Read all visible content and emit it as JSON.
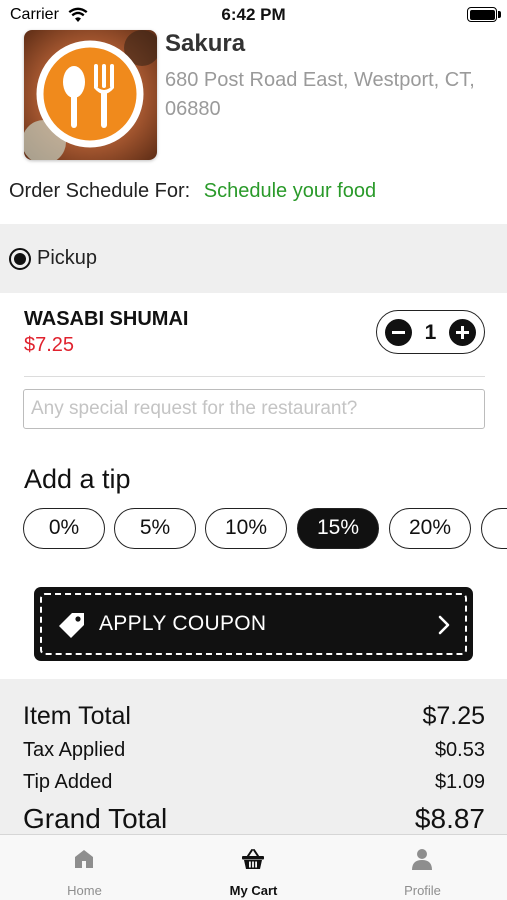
{
  "status_bar": {
    "carrier": "Carrier",
    "time": "6:42 PM"
  },
  "restaurant": {
    "name": "Sakura",
    "address": "680 Post Road East, Westport, CT, 06880",
    "logo_icon": "utensils-logo-icon"
  },
  "schedule": {
    "label": "Order Schedule For:",
    "link": "Schedule your food"
  },
  "order_type": {
    "label": "Pickup",
    "selected": true
  },
  "cart_item": {
    "name": "WASABI SHUMAI",
    "price": "$7.25",
    "quantity": "1"
  },
  "special_request": {
    "placeholder": "Any special request for the restaurant?",
    "value": ""
  },
  "tip": {
    "title": "Add a tip",
    "options": [
      "0%",
      "5%",
      "10%",
      "15%",
      "20%"
    ],
    "selected": "15%"
  },
  "coupon": {
    "label": "APPLY COUPON"
  },
  "totals": {
    "item_total_label": "Item Total",
    "item_total": "$7.25",
    "tax_label": "Tax Applied",
    "tax": "$0.53",
    "tip_label": "Tip Added",
    "tip": "$1.09",
    "grand_total_label": "Grand Total",
    "grand_total": "$8.87"
  },
  "tab_bar": {
    "items": [
      {
        "label": "Home",
        "icon": "home-icon",
        "active": false
      },
      {
        "label": "My Cart",
        "icon": "basket-icon",
        "active": true
      },
      {
        "label": "Profile",
        "icon": "person-icon",
        "active": false
      }
    ]
  },
  "colors": {
    "price": "#e0222e",
    "link": "#2a9a2a",
    "logo_orange": "#f08a1c",
    "accent_dark": "#111111"
  }
}
